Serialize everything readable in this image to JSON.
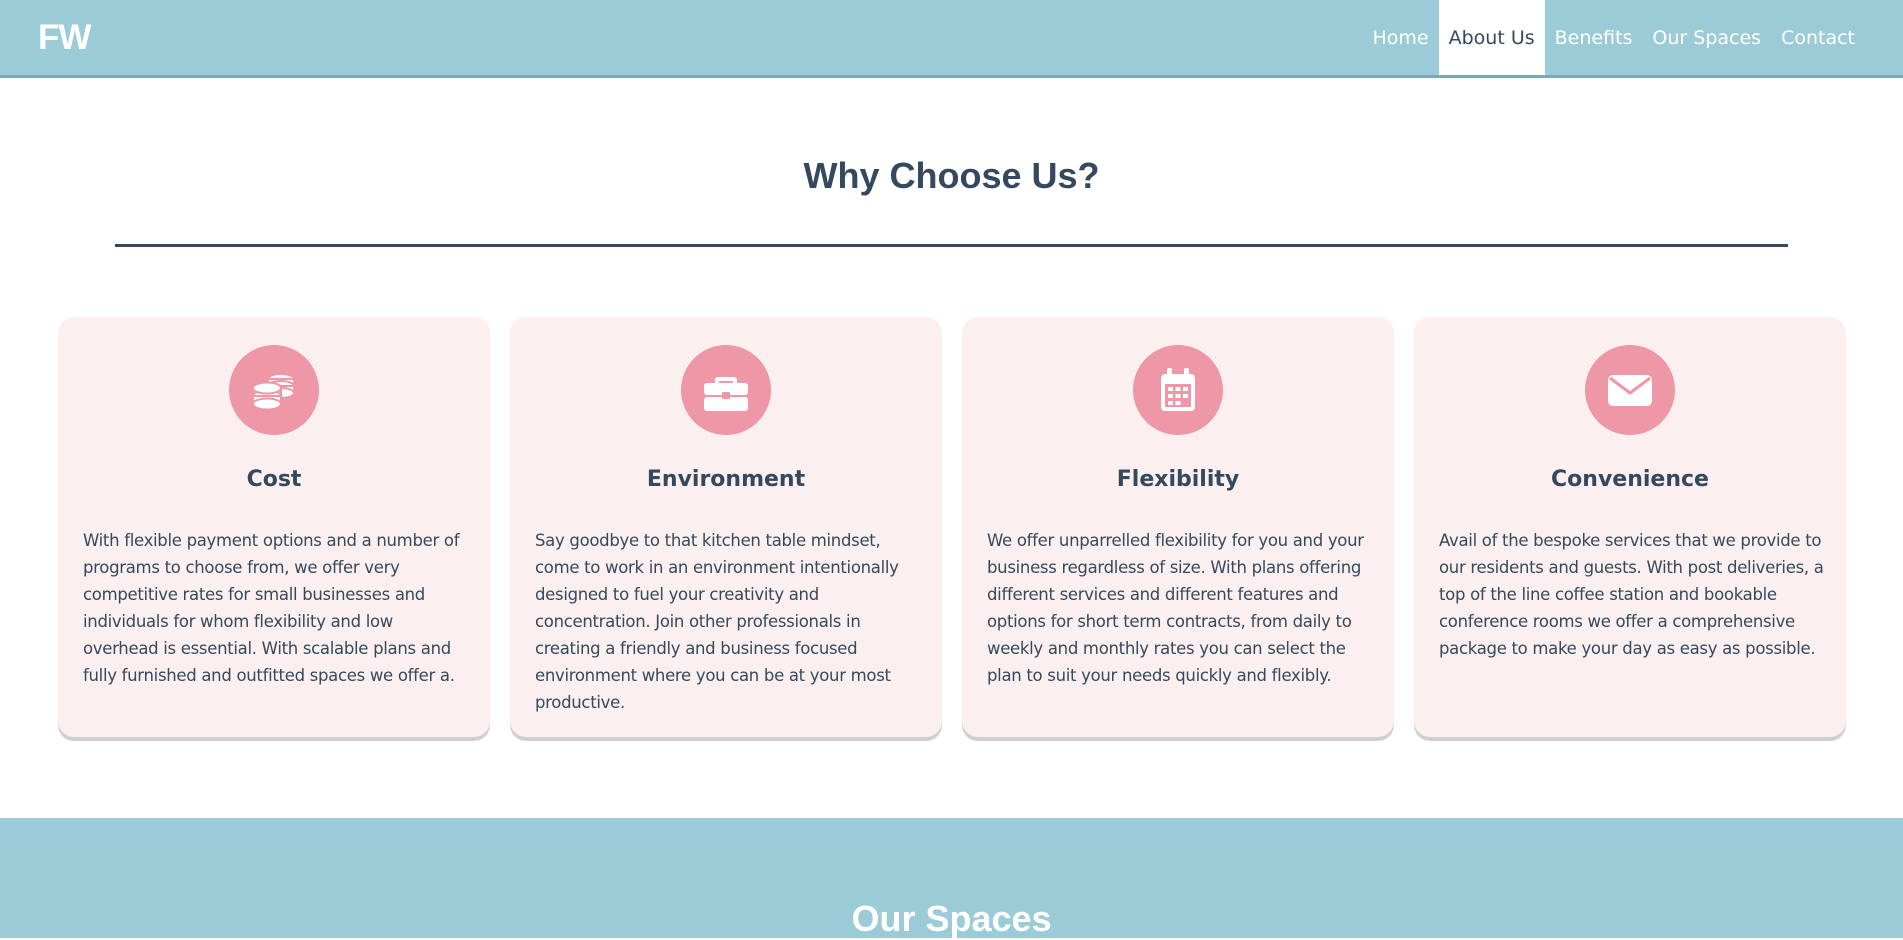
{
  "header": {
    "logo": "FW",
    "nav": [
      {
        "label": "Home",
        "active": false
      },
      {
        "label": "About Us",
        "active": true
      },
      {
        "label": "Benefits",
        "active": false
      },
      {
        "label": "Our Spaces",
        "active": false
      },
      {
        "label": "Contact",
        "active": false
      }
    ]
  },
  "colors": {
    "header_bg": "#9ccbd8",
    "card_bg": "#fbefef",
    "icon_bg": "#ee97a6",
    "heading": "#34495e"
  },
  "benefits": {
    "title": "Why Choose Us?",
    "cards": [
      {
        "icon": "coins-icon",
        "title": "Cost",
        "text": "With flexible payment options and a number of programs to choose from, we offer very competitive rates for small businesses and individuals for whom flexibility and low overhead is essential. With scalable plans and fully furnished and outfitted spaces we offer a."
      },
      {
        "icon": "briefcase-icon",
        "title": "Environment",
        "text": "Say goodbye to that kitchen table mindset, come to work in an environment intentionally designed to fuel your creativity and concentration. Join other professionals in creating a friendly and business focused environment where you can be at your most productive."
      },
      {
        "icon": "calendar-icon",
        "title": "Flexibility",
        "text": "We offer unparrelled flexibility for you and your business regardless of size. With plans offering different services and different features and options for short term contracts, from daily to weekly and monthly rates you can select the plan to suit your needs quickly and flexibly."
      },
      {
        "icon": "envelope-icon",
        "title": "Convenience",
        "text": "Avail of the bespoke services that we provide to our residents and guests. With post deliveries, a top of the line coffee station and bookable conference rooms we offer a comprehensive package to make your day as easy as possible."
      }
    ]
  },
  "spaces": {
    "title": "Our Spaces"
  }
}
